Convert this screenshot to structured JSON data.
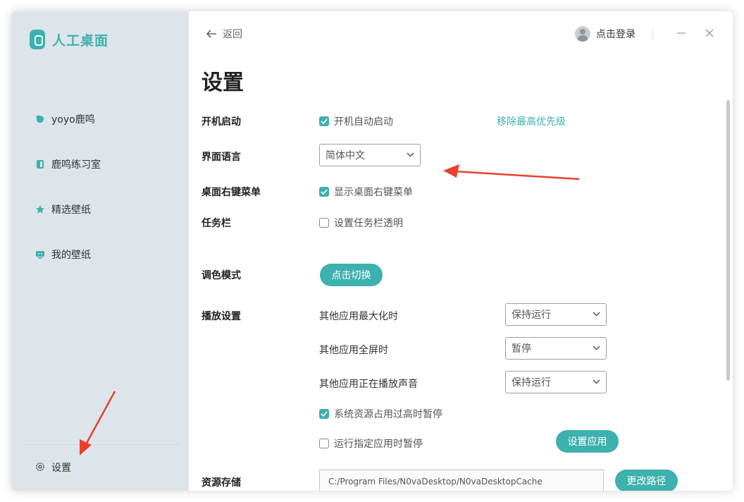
{
  "sidebar": {
    "logo_text": "人工桌面",
    "items": [
      {
        "label": "yoyo鹿鸣",
        "icon": "leaf-icon"
      },
      {
        "label": "鹿鸣练习室",
        "icon": "door-icon"
      },
      {
        "label": "精选壁纸",
        "icon": "star-icon"
      },
      {
        "label": "我的壁纸",
        "icon": "monitor-icon"
      }
    ],
    "settings_label": "设置"
  },
  "header": {
    "back_label": "返回",
    "login_label": "点击登录"
  },
  "page_title": "设置",
  "settings": {
    "startup": {
      "label": "开机启动",
      "checkbox": "开机自动启动",
      "checked": true,
      "link": "移除最高优先级"
    },
    "language": {
      "label": "界面语言",
      "value": "简体中文"
    },
    "context_menu": {
      "label": "桌面右键菜单",
      "checkbox": "显示桌面右键菜单",
      "checked": true
    },
    "taskbar": {
      "label": "任务栏",
      "checkbox": "设置任务栏透明",
      "checked": false
    },
    "color_mode": {
      "label": "调色模式",
      "button": "点击切换"
    },
    "playback": {
      "label": "播放设置",
      "rows": [
        {
          "label": "其他应用最大化时",
          "value": "保持运行"
        },
        {
          "label": "其他应用全屏时",
          "value": "暂停"
        },
        {
          "label": "其他应用正在播放声音",
          "value": "保持运行"
        }
      ],
      "pause_high_usage": {
        "label": "系统资源占用过高时暂停",
        "checked": true
      },
      "pause_app": {
        "label": "运行指定应用时暂停",
        "checked": false
      },
      "set_app_button": "设置应用"
    },
    "storage": {
      "label": "资源存储",
      "path": "C:/Program Files/N0vaDesktop/N0vaDesktopCache",
      "button": "更改路径"
    }
  },
  "colors": {
    "accent": "#3db1ad",
    "annotation": "#e8412f"
  }
}
